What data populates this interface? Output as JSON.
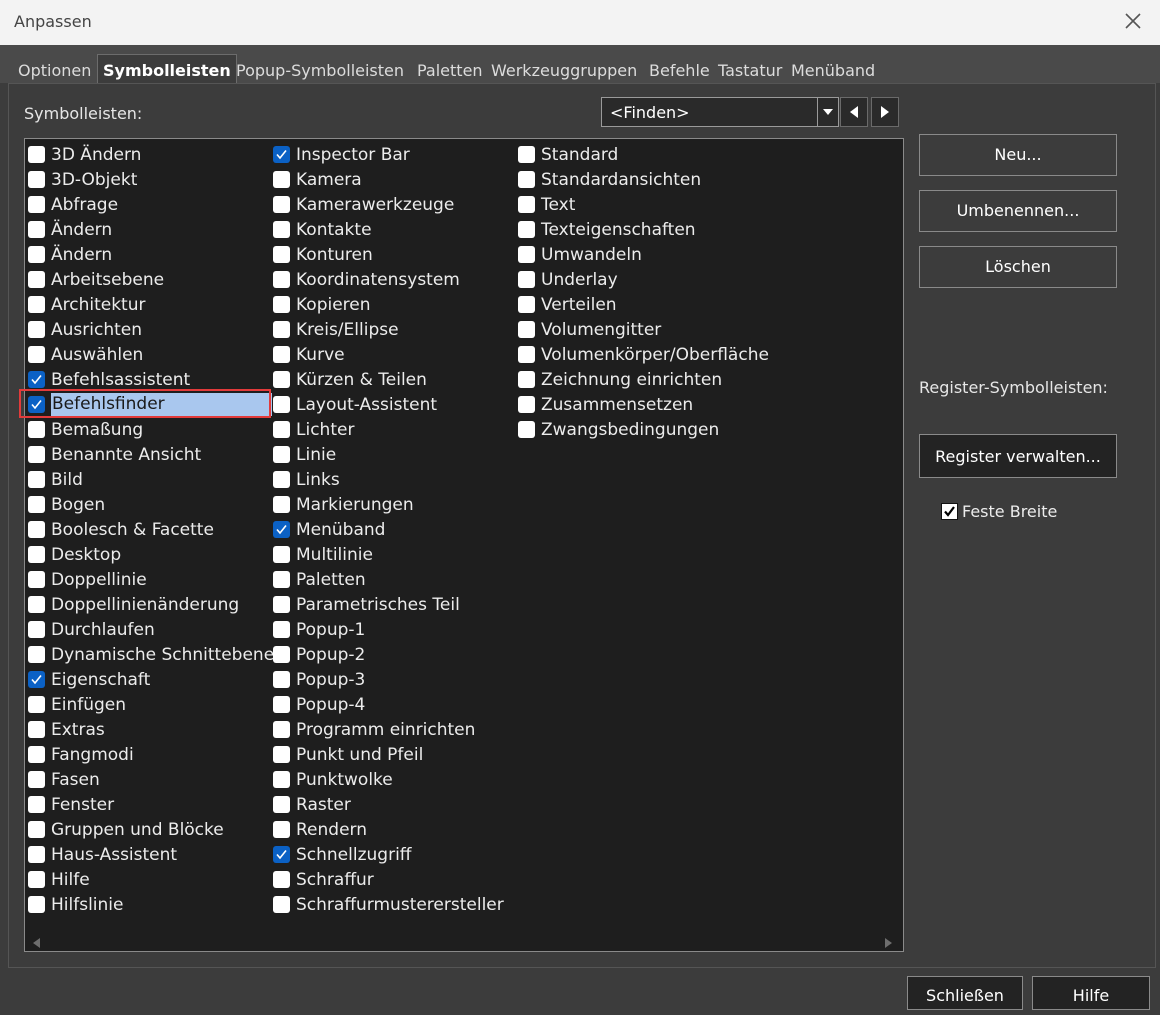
{
  "window": {
    "title": "Anpassen"
  },
  "tabs": [
    {
      "label": "Optionen"
    },
    {
      "label": "Symbolleisten",
      "active": true
    },
    {
      "label": "Popup-Symbolleisten"
    },
    {
      "label": "Paletten"
    },
    {
      "label": "Werkzeuggruppen"
    },
    {
      "label": "Befehle"
    },
    {
      "label": "Tastatur"
    },
    {
      "label": "Menüband"
    }
  ],
  "toolbars_label": "Symbolleisten:",
  "search": {
    "value": "<Finden>"
  },
  "columns": [
    [
      {
        "label": "3D Ändern",
        "checked": false
      },
      {
        "label": "3D-Objekt",
        "checked": false
      },
      {
        "label": "Abfrage",
        "checked": false
      },
      {
        "label": "Ändern",
        "checked": false
      },
      {
        "label": "Ändern",
        "checked": false
      },
      {
        "label": "Arbeitsebene",
        "checked": false
      },
      {
        "label": "Architektur",
        "checked": false
      },
      {
        "label": "Ausrichten",
        "checked": false
      },
      {
        "label": "Auswählen",
        "checked": false
      },
      {
        "label": "Befehlsassistent",
        "checked": true
      },
      {
        "label": "Befehlsfinder",
        "checked": true,
        "selected": true
      },
      {
        "label": "Bemaßung",
        "checked": false
      },
      {
        "label": "Benannte Ansicht",
        "checked": false
      },
      {
        "label": "Bild",
        "checked": false
      },
      {
        "label": "Bogen",
        "checked": false
      },
      {
        "label": "Boolesch & Facette",
        "checked": false
      },
      {
        "label": "Desktop",
        "checked": false
      },
      {
        "label": "Doppellinie",
        "checked": false
      },
      {
        "label": "Doppellinienänderung",
        "checked": false
      },
      {
        "label": "Durchlaufen",
        "checked": false
      },
      {
        "label": "Dynamische Schnittebene",
        "checked": false
      },
      {
        "label": "Eigenschaft",
        "checked": true
      },
      {
        "label": "Einfügen",
        "checked": false
      },
      {
        "label": "Extras",
        "checked": false
      },
      {
        "label": "Fangmodi",
        "checked": false
      },
      {
        "label": "Fasen",
        "checked": false
      },
      {
        "label": "Fenster",
        "checked": false
      },
      {
        "label": "Gruppen und Blöcke",
        "checked": false
      },
      {
        "label": "Haus-Assistent",
        "checked": false
      },
      {
        "label": "Hilfe",
        "checked": false
      },
      {
        "label": "Hilfslinie",
        "checked": false
      }
    ],
    [
      {
        "label": "Inspector Bar",
        "checked": true
      },
      {
        "label": "Kamera",
        "checked": false
      },
      {
        "label": "Kamerawerkzeuge",
        "checked": false
      },
      {
        "label": "Kontakte",
        "checked": false
      },
      {
        "label": "Konturen",
        "checked": false
      },
      {
        "label": "Koordinatensystem",
        "checked": false
      },
      {
        "label": "Kopieren",
        "checked": false
      },
      {
        "label": "Kreis/Ellipse",
        "checked": false
      },
      {
        "label": "Kurve",
        "checked": false
      },
      {
        "label": "Kürzen & Teilen",
        "checked": false
      },
      {
        "label": "Layout-Assistent",
        "checked": false
      },
      {
        "label": "Lichter",
        "checked": false
      },
      {
        "label": "Linie",
        "checked": false
      },
      {
        "label": "Links",
        "checked": false
      },
      {
        "label": "Markierungen",
        "checked": false
      },
      {
        "label": "Menüband",
        "checked": true
      },
      {
        "label": "Multilinie",
        "checked": false
      },
      {
        "label": "Paletten",
        "checked": false
      },
      {
        "label": "Parametrisches Teil",
        "checked": false
      },
      {
        "label": "Popup-1",
        "checked": false
      },
      {
        "label": "Popup-2",
        "checked": false
      },
      {
        "label": "Popup-3",
        "checked": false
      },
      {
        "label": "Popup-4",
        "checked": false
      },
      {
        "label": "Programm einrichten",
        "checked": false
      },
      {
        "label": "Punkt und Pfeil",
        "checked": false
      },
      {
        "label": "Punktwolke",
        "checked": false
      },
      {
        "label": "Raster",
        "checked": false
      },
      {
        "label": "Rendern",
        "checked": false
      },
      {
        "label": "Schnellzugriff",
        "checked": true
      },
      {
        "label": "Schraffur",
        "checked": false
      },
      {
        "label": "Schraffurmusterersteller",
        "checked": false
      }
    ],
    [
      {
        "label": "Standard",
        "checked": false
      },
      {
        "label": "Standardansichten",
        "checked": false
      },
      {
        "label": "Text",
        "checked": false
      },
      {
        "label": "Texteigenschaften",
        "checked": false
      },
      {
        "label": "Umwandeln",
        "checked": false
      },
      {
        "label": "Underlay",
        "checked": false
      },
      {
        "label": "Verteilen",
        "checked": false
      },
      {
        "label": "Volumengitter",
        "checked": false
      },
      {
        "label": "Volumenkörper/Oberfläche",
        "checked": false
      },
      {
        "label": "Zeichnung einrichten",
        "checked": false
      },
      {
        "label": "Zusammensetzen",
        "checked": false
      },
      {
        "label": "Zwangsbedingungen",
        "checked": false
      }
    ]
  ],
  "buttons": {
    "new": "Neu...",
    "rename": "Umbenennen...",
    "delete": "Löschen",
    "manage_register": "Register verwalten...",
    "close": "Schließen",
    "help": "Hilfe"
  },
  "register_label": "Register-Symbolleisten:",
  "fixed_width": {
    "label": "Feste Breite",
    "checked": true
  },
  "colors": {
    "accent": "#0b61c5",
    "selection": "#a9c7ee",
    "highlight_frame": "#e23b3b"
  }
}
